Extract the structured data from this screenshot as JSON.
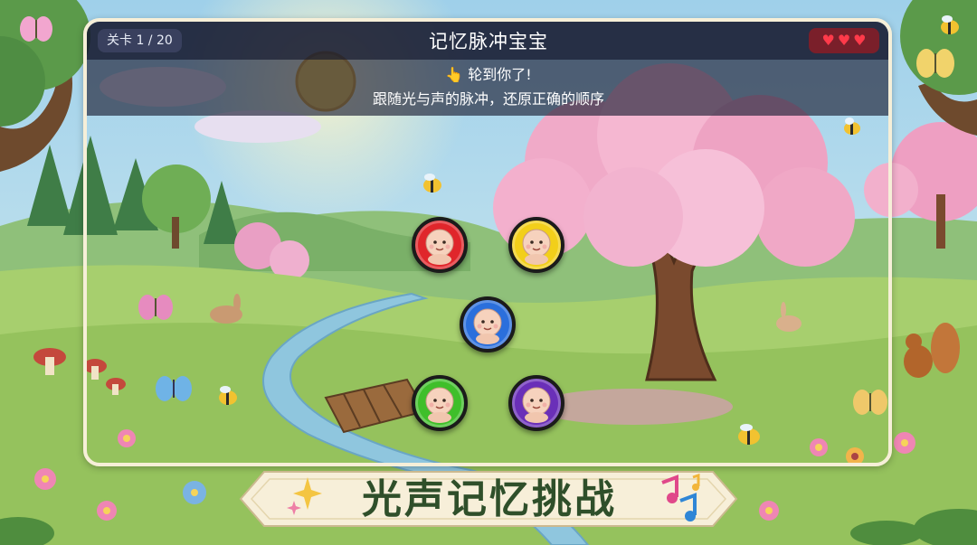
{
  "header": {
    "level_text": "关卡 1 / 20",
    "title": "记忆脉冲宝宝",
    "lives": [
      "♥",
      "♥",
      "♥"
    ]
  },
  "prompt": {
    "turn_text": "👆 轮到你了!",
    "instruction": "跟随光与声的脉冲，还原正确的顺序"
  },
  "pads": [
    {
      "name": "red-baby-pad",
      "color": "#e0262b"
    },
    {
      "name": "yellow-baby-pad",
      "color": "#f2cf1a"
    },
    {
      "name": "blue-baby-pad",
      "color": "#2b6fdc"
    },
    {
      "name": "green-baby-pad",
      "color": "#3fbf2a"
    },
    {
      "name": "purple-baby-pad",
      "color": "#6a2fb8"
    }
  ],
  "footer": {
    "title": "光声记忆挑战"
  },
  "colors": {
    "topbar": "#14182d",
    "heart": "#ff3a4a",
    "title_green": "#2f4f2a",
    "frame": "#f6efd8"
  }
}
